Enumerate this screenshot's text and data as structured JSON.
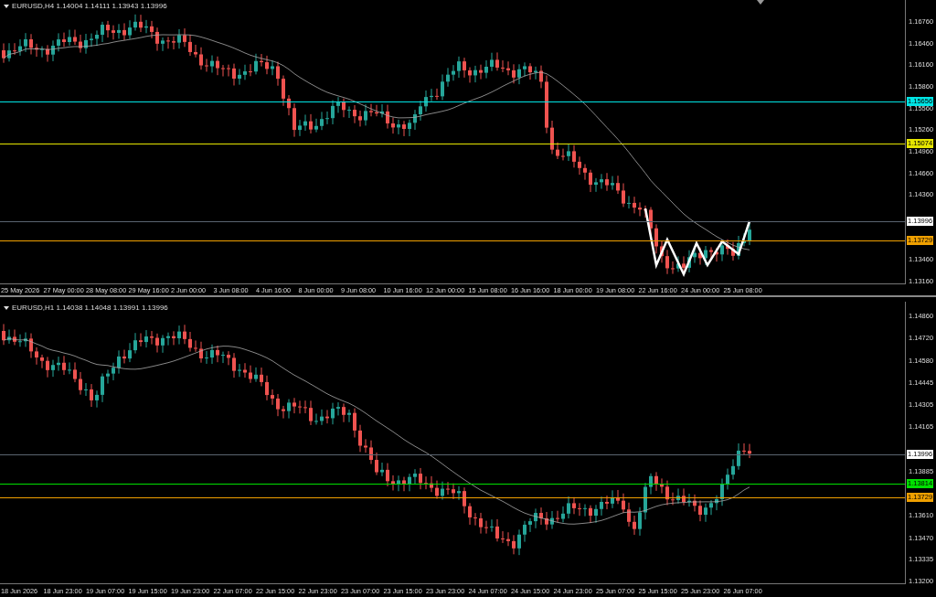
{
  "panes": [
    {
      "header": "EURUSD,H4  1.14004 1.14111 1.13943 1.13996",
      "price_ticks": [
        "1.16760",
        "1.16460",
        "1.16160",
        "1.15860",
        "1.15560",
        "1.15260",
        "1.14960",
        "1.14660",
        "1.14360",
        "1.13460",
        "1.13160"
      ],
      "level_lines": [
        {
          "price": "1.15656",
          "color": "#00e5e5"
        },
        {
          "price": "1.15074",
          "color": "#e5e500"
        },
        {
          "price": "1.13996",
          "color": "#ffffff"
        },
        {
          "price": "1.13729",
          "color": "#f0a000"
        }
      ],
      "time_labels": [
        "25 May 2026",
        "27 May 00:00",
        "28 May 08:00",
        "29 May 16:00",
        "2 Jun 00:00",
        "3 Jun 08:00",
        "4 Jun 16:00",
        "8 Jun 00:00",
        "9 Jun 08:00",
        "10 Jun 16:00",
        "12 Jun 00:00",
        "15 Jun 08:00",
        "16 Jun 16:00",
        "18 Jun 00:00",
        "19 Jun 08:00",
        "22 Jun 16:00",
        "24 Jun 00:00",
        "25 Jun 08:00"
      ]
    },
    {
      "header": "EURUSD,H1  1.14038 1.14048 1.13991 1.13996",
      "price_ticks": [
        "1.14860",
        "1.14720",
        "1.14580",
        "1.14445",
        "1.14305",
        "1.14165",
        "1.13885",
        "1.13610",
        "1.13470",
        "1.13335",
        "1.13200"
      ],
      "level_lines": [
        {
          "price": "1.13996",
          "color": "#ffffff"
        },
        {
          "price": "1.13814",
          "color": "#00e000"
        },
        {
          "price": "1.13729",
          "color": "#f0a000"
        }
      ],
      "time_labels": [
        "18 Jun 2026",
        "18 Jun 23:00",
        "19 Jun 07:00",
        "19 Jun 15:00",
        "19 Jun 23:00",
        "22 Jun 07:00",
        "22 Jun 15:00",
        "22 Jun 23:00",
        "23 Jun 07:00",
        "23 Jun 15:00",
        "23 Jun 23:00",
        "24 Jun 07:00",
        "24 Jun 15:00",
        "24 Jun 23:00",
        "25 Jun 07:00",
        "25 Jun 15:00",
        "25 Jun 23:00",
        "26 Jun 07:00"
      ]
    }
  ]
}
